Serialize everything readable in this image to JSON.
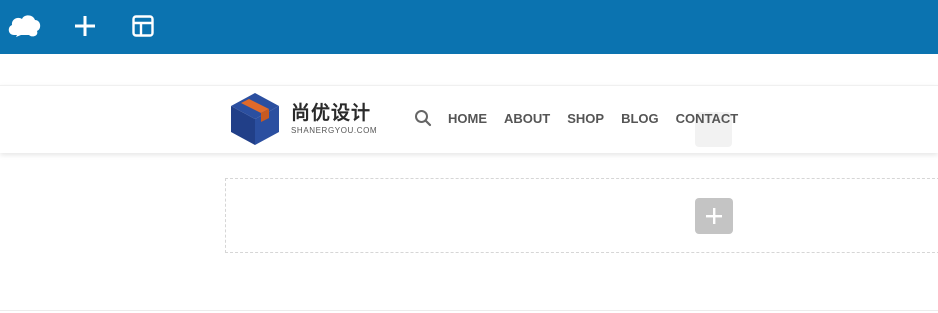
{
  "toolbar": {
    "background": "#0b73b0",
    "buttons": [
      {
        "icon": "cloud-icon"
      },
      {
        "icon": "plus-icon"
      },
      {
        "icon": "layout-icon"
      }
    ]
  },
  "header": {
    "logo": {
      "name_cn": "尚优设计",
      "domain": "SHANERGYOU.COM",
      "colors": {
        "blue": "#2b4fa0",
        "orange": "#e06a2b"
      }
    },
    "search_icon": "search-icon",
    "nav": [
      "HOME",
      "ABOUT",
      "SHOP",
      "BLOG",
      "CONTACT"
    ]
  },
  "section": {
    "add_icon": "plus-icon"
  }
}
